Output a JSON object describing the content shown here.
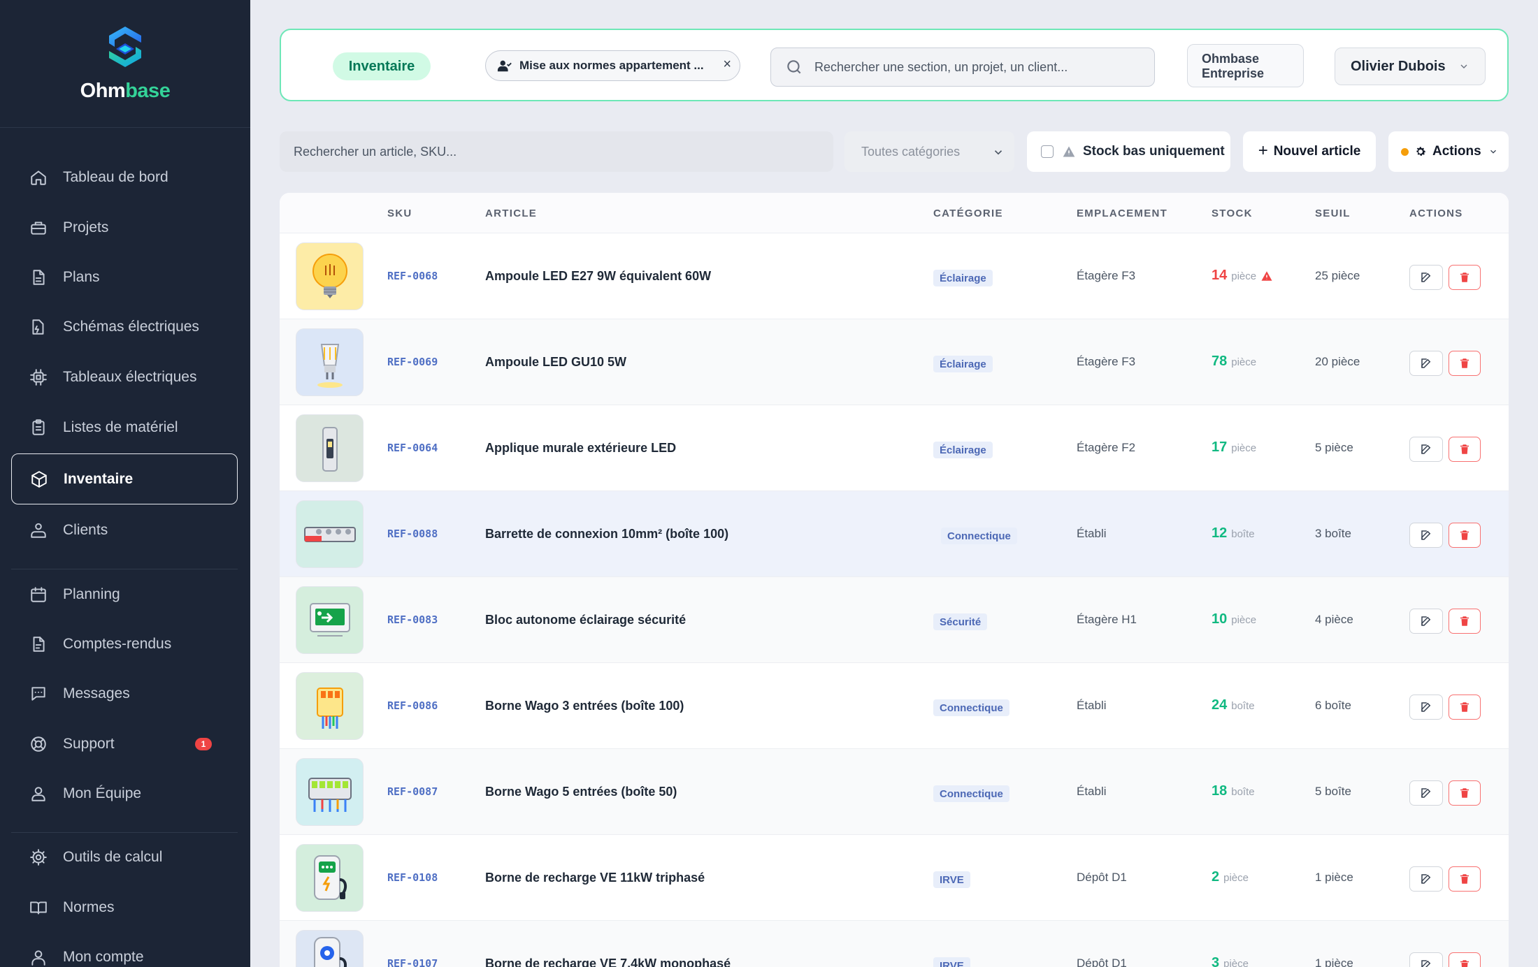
{
  "brand": {
    "name_a": "Ohm",
    "name_b": "base"
  },
  "sidebar": {
    "items": [
      {
        "label": "Tableau de bord",
        "icon": "home-icon"
      },
      {
        "label": "Projets",
        "icon": "briefcase-icon"
      },
      {
        "label": "Plans",
        "icon": "document-icon"
      },
      {
        "label": "Schémas électriques",
        "icon": "schema-icon"
      },
      {
        "label": "Tableaux électriques",
        "icon": "chip-icon"
      },
      {
        "label": "Listes de matériel",
        "icon": "clipboard-icon"
      },
      {
        "label": "Inventaire",
        "icon": "cube-icon",
        "active": true
      },
      {
        "label": "Clients",
        "icon": "users-icon"
      },
      {
        "label": "Planning",
        "icon": "calendar-icon"
      },
      {
        "label": "Comptes-rendus",
        "icon": "report-icon"
      },
      {
        "label": "Messages",
        "icon": "chat-icon"
      },
      {
        "label": "Support",
        "icon": "lifebuoy-icon",
        "badge": "1"
      },
      {
        "label": "Mon Équipe",
        "icon": "team-icon"
      },
      {
        "label": "Outils de calcul",
        "icon": "gear-icon"
      },
      {
        "label": "Normes",
        "icon": "book-icon"
      },
      {
        "label": "Mon compte",
        "icon": "user-icon"
      }
    ]
  },
  "topbar": {
    "section_pill": "Inventaire",
    "project_pill": "Mise aux normes appartement ...",
    "project_close": "×",
    "search_placeholder": "Rechercher une section, un projet, un client...",
    "company_line1": "Ohmbase",
    "company_line2": "Entreprise",
    "user_name": "Olivier Dubois"
  },
  "toolbar": {
    "search_placeholder": "Rechercher un article, SKU...",
    "category_select": "Toutes catégories",
    "low_stock_label": "Stock bas uniquement",
    "new_item_label": "Nouvel article",
    "new_item_plus": "+",
    "actions_label": "Actions"
  },
  "table": {
    "headers": {
      "sku": "SKU",
      "article": "ARTICLE",
      "category": "CATÉGORIE",
      "location": "EMPLACEMENT",
      "stock": "STOCK",
      "threshold": "SEUIL",
      "actions": "ACTIONS"
    },
    "rows": [
      {
        "sku": "REF-0068",
        "article": "Ampoule LED E27 9W équivalent 60W",
        "category": "Éclairage",
        "location": "Étagère F3",
        "stock": "14",
        "unit": "pièce",
        "threshold": "25 pièce",
        "low": true,
        "thumb": "bulb-icon"
      },
      {
        "sku": "REF-0069",
        "article": "Ampoule LED GU10 5W",
        "category": "Éclairage",
        "location": "Étagère F3",
        "stock": "78",
        "unit": "pièce",
        "threshold": "20 pièce",
        "low": false,
        "thumb": "spot-bulb-icon"
      },
      {
        "sku": "REF-0064",
        "article": "Applique murale extérieure LED",
        "category": "Éclairage",
        "location": "Étagère F2",
        "stock": "17",
        "unit": "pièce",
        "threshold": "5 pièce",
        "low": false,
        "thumb": "wall-light-icon"
      },
      {
        "sku": "REF-0088",
        "article": "Barrette de connexion 10mm² (boîte 100)",
        "category": "Connectique",
        "location": "Établi",
        "stock": "12",
        "unit": "boîte",
        "threshold": "3 boîte",
        "low": false,
        "thumb": "terminal-strip-icon"
      },
      {
        "sku": "REF-0083",
        "article": "Bloc autonome éclairage sécurité",
        "category": "Sécurité",
        "location": "Étagère H1",
        "stock": "10",
        "unit": "pièce",
        "threshold": "4 pièce",
        "low": false,
        "thumb": "emergency-light-icon"
      },
      {
        "sku": "REF-0086",
        "article": "Borne Wago 3 entrées (boîte 100)",
        "category": "Connectique",
        "location": "Établi",
        "stock": "24",
        "unit": "boîte",
        "threshold": "6 boîte",
        "low": false,
        "thumb": "wago-3-icon"
      },
      {
        "sku": "REF-0087",
        "article": "Borne Wago 5 entrées (boîte 50)",
        "category": "Connectique",
        "location": "Établi",
        "stock": "18",
        "unit": "boîte",
        "threshold": "5 boîte",
        "low": false,
        "thumb": "wago-5-icon"
      },
      {
        "sku": "REF-0108",
        "article": "Borne de recharge VE 11kW triphasé",
        "category": "IRVE",
        "location": "Dépôt D1",
        "stock": "2",
        "unit": "pièce",
        "threshold": "1 pièce",
        "low": false,
        "thumb": "ev-charger-icon"
      },
      {
        "sku": "REF-0107",
        "article": "Borne de recharge VE 7,4kW monophasé",
        "category": "IRVE",
        "location": "Dépôt D1",
        "stock": "3",
        "unit": "pièce",
        "threshold": "1 pièce",
        "low": false,
        "thumb": "ev-charger-icon"
      }
    ]
  },
  "colors": {
    "accent": "#34d399",
    "sidebar_bg": "#1c2536",
    "danger": "#ef4444",
    "success": "#10b981",
    "link": "#4f6fc4"
  }
}
